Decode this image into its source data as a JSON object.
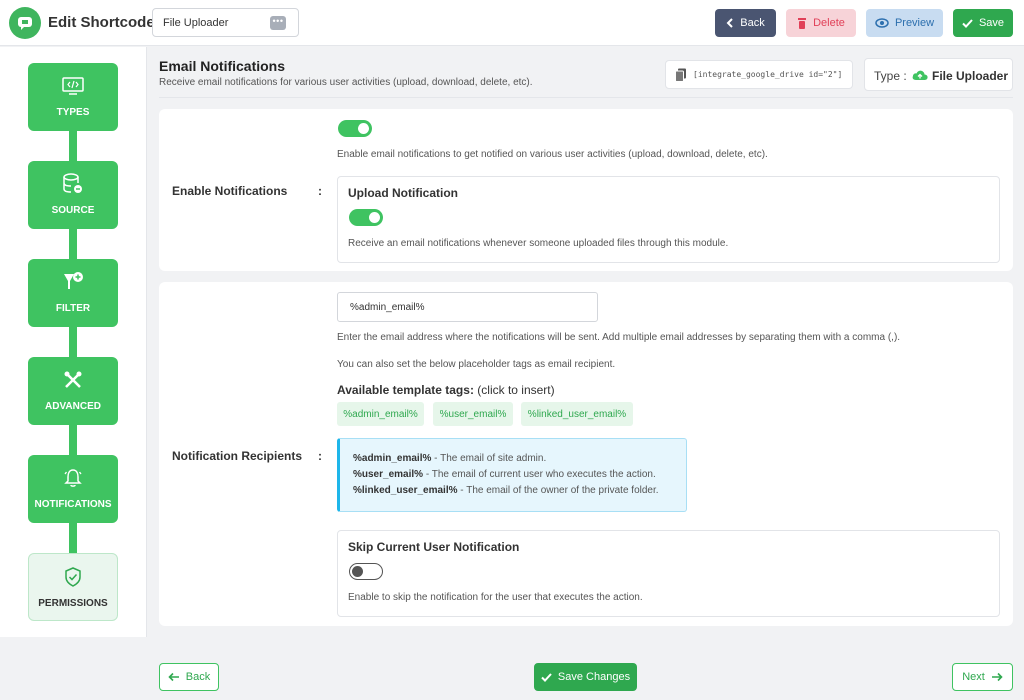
{
  "header": {
    "title": "Edit Shortcode",
    "shortcode_title": "File Uploader",
    "title_options": "•••",
    "back_label": "Back",
    "delete_label": "Delete",
    "preview_label": "Preview",
    "save_label": "Save"
  },
  "sidebar": {
    "steps": [
      {
        "label": "TYPES",
        "icon": "code-window-icon"
      },
      {
        "label": "SOURCE",
        "icon": "database-icon"
      },
      {
        "label": "FILTER",
        "icon": "filter-icon"
      },
      {
        "label": "ADVANCED",
        "icon": "tools-icon"
      },
      {
        "label": "NOTIFICATIONS",
        "icon": "bell-icon"
      },
      {
        "label": "PERMISSIONS",
        "icon": "shield-check-icon"
      }
    ],
    "active_step": "PERMISSIONS"
  },
  "main": {
    "title": "Email Notifications",
    "subtitle": "Receive email notifications for various user activities (upload, download, delete, etc).",
    "shortcode": "[integrate_google_drive id=\"2\"]",
    "type_label": "Type :",
    "type_value": "File Uploader",
    "enable": {
      "label": "Enable Notifications",
      "colon": ":",
      "enabled": true,
      "description": "Enable email notifications to get notified on various user activities (upload, download, delete, etc).",
      "upload_title": "Upload Notification",
      "upload_enabled": true,
      "upload_description": "Receive an email notifications whenever someone uploaded files through this module."
    },
    "recipients": {
      "label": "Notification Recipients",
      "colon": ":",
      "input_value": "%admin_email%",
      "description1": "Enter the email address where the notifications will be sent. Add multiple email addresses by separating them with a comma (,).",
      "description2": "You can also set the below placeholder tags as email recipient.",
      "tags_title": "Available template tags:",
      "tags_hint": "(click to insert)",
      "tags": [
        "%admin_email%",
        "%user_email%",
        "%linked_user_email%"
      ],
      "info": [
        {
          "tag": "%admin_email%",
          "text": " - The email of site admin."
        },
        {
          "tag": "%user_email%",
          "text": " - The email of current user who executes the action."
        },
        {
          "tag": "%linked_user_email%",
          "text": " - The email of the owner of the private folder."
        }
      ],
      "skip_title": "Skip Current User Notification",
      "skip_enabled": false,
      "skip_description": "Enable to skip the notification for the user that executes the action."
    }
  },
  "footer": {
    "back_label": "Back",
    "save_label": "Save Changes",
    "next_label": "Next"
  },
  "colors": {
    "accent": "#3fc361",
    "dark_button": "#4a5571",
    "delete_bg": "#f7d3d8",
    "preview_bg": "#c8dcf1",
    "info_border": "#1eb6ea"
  }
}
